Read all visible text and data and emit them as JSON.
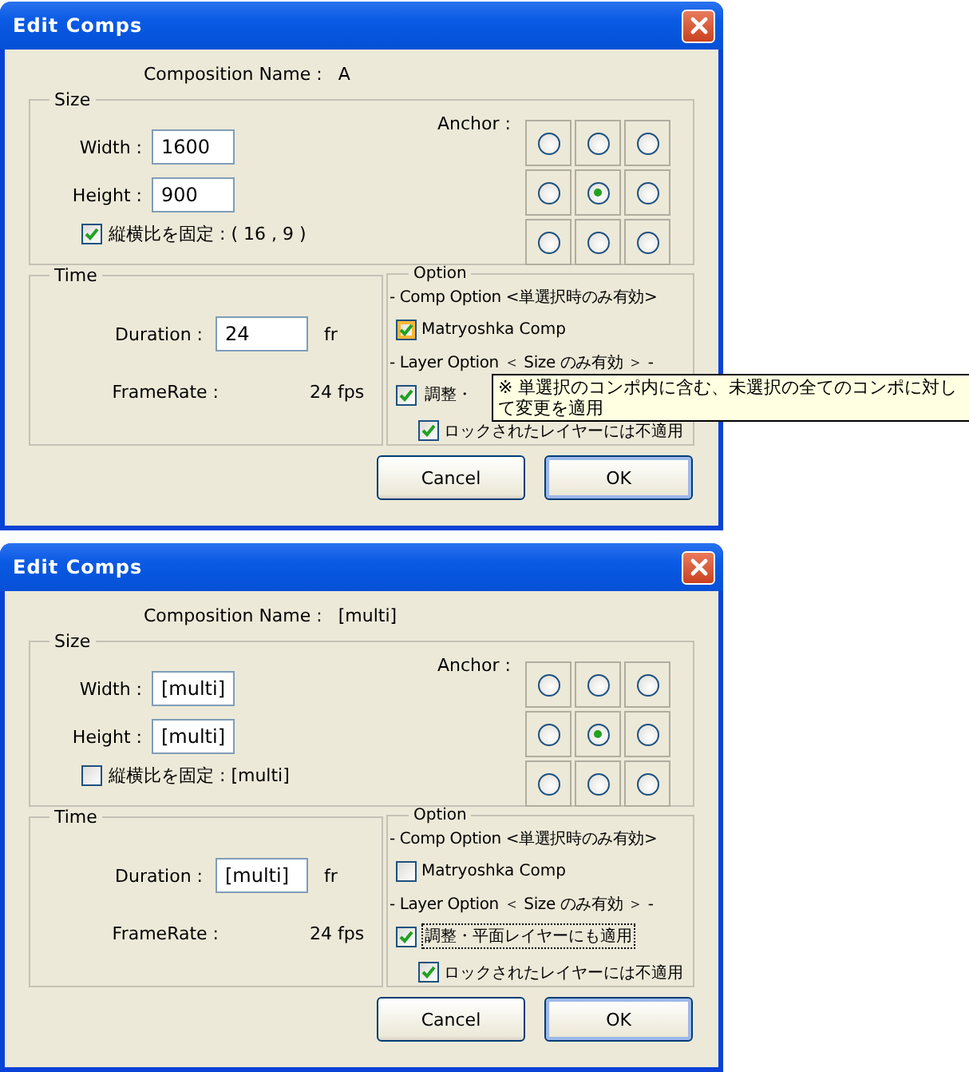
{
  "dialogs": [
    {
      "title": "Edit Comps",
      "composition_name_label": "Composition Name :",
      "composition_name": "A",
      "size": {
        "legend": "Size",
        "width_label": "Width :",
        "width_value": "1600",
        "height_label": "Height :",
        "height_value": "900",
        "aspect_label": "縦横比を固定 : ( 16 , 9 )",
        "aspect_checked": true,
        "anchor_label": "Anchor :",
        "anchors": [
          {
            "selected": false
          },
          {
            "selected": false
          },
          {
            "selected": false
          },
          {
            "selected": false
          },
          {
            "selected": true
          },
          {
            "selected": false
          },
          {
            "selected": false
          },
          {
            "selected": false
          },
          {
            "selected": false
          }
        ]
      },
      "time": {
        "legend": "Time",
        "duration_label": "Duration :",
        "duration_value": "24",
        "duration_unit": "fr",
        "framerate_label": "FrameRate :",
        "framerate_value": "24 fps"
      },
      "option": {
        "legend": "Option",
        "comp_heading": "- Comp Option <単選択時のみ有効>",
        "matryoshka": {
          "label": "Matryoshka Comp",
          "checked": true,
          "hovered": true
        },
        "layer_heading": "- Layer Option ＜ Size のみ有効 ＞ -",
        "adjust": {
          "label": "調整・",
          "checked": true,
          "focused": false
        },
        "lock": {
          "label": "ロックされたレイヤーには不適用",
          "checked": true
        }
      },
      "buttons": [
        {
          "label": "Cancel",
          "default": false
        },
        {
          "label": "OK",
          "default": true
        }
      ],
      "tooltip": "※ 単選択のコンポ内に含む、未選択の全てのコンポに対して変更を適用"
    },
    {
      "title": "Edit Comps",
      "composition_name_label": "Composition Name :",
      "composition_name": "[multi]",
      "size": {
        "legend": "Size",
        "width_label": "Width :",
        "width_value": "[multi]",
        "height_label": "Height :",
        "height_value": "[multi]",
        "aspect_label": "縦横比を固定 : [multi]",
        "aspect_checked": false,
        "anchor_label": "Anchor :",
        "anchors": [
          {
            "selected": false
          },
          {
            "selected": false
          },
          {
            "selected": false
          },
          {
            "selected": false
          },
          {
            "selected": true
          },
          {
            "selected": false
          },
          {
            "selected": false
          },
          {
            "selected": false
          },
          {
            "selected": false
          }
        ]
      },
      "time": {
        "legend": "Time",
        "duration_label": "Duration :",
        "duration_value": "[multi]",
        "duration_unit": "fr",
        "framerate_label": "FrameRate :",
        "framerate_value": "24 fps"
      },
      "option": {
        "legend": "Option",
        "comp_heading": "- Comp Option <単選択時のみ有効>",
        "matryoshka": {
          "label": "Matryoshka Comp",
          "checked": false,
          "hovered": false
        },
        "layer_heading": "- Layer Option ＜ Size のみ有効 ＞ -",
        "adjust": {
          "label": "調整・平面レイヤーにも適用",
          "checked": true,
          "focused": true
        },
        "lock": {
          "label": "ロックされたレイヤーには不適用",
          "checked": true
        }
      },
      "buttons": [
        {
          "label": "Cancel",
          "default": false
        },
        {
          "label": "OK",
          "default": true
        }
      ]
    }
  ]
}
